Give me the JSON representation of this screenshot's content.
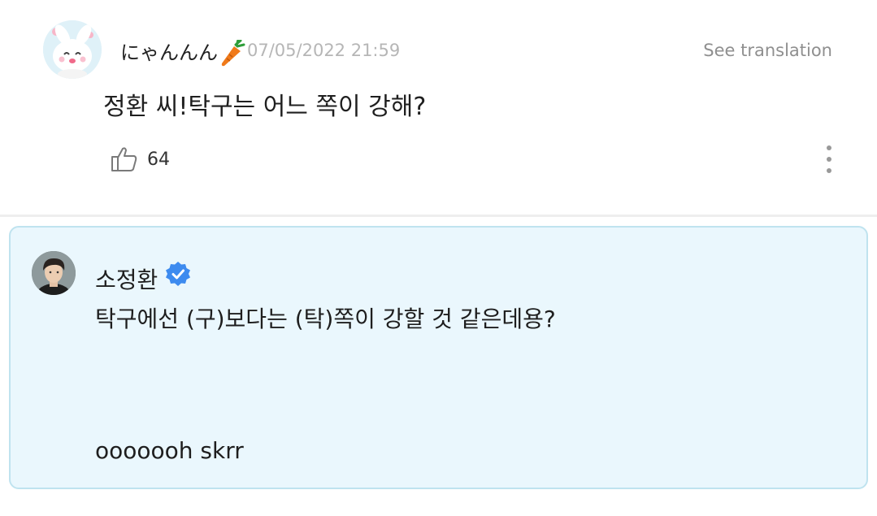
{
  "post": {
    "username": "にゃんんん",
    "username_emoji": "carrot-icon",
    "timestamp": "07/05/2022 21:59",
    "see_translation": "See translation",
    "text": "정환 씨!탁구는 어느 쪽이 강해?",
    "like_count": "64"
  },
  "reply": {
    "author": "소정환",
    "verified": true,
    "line1": "탁구에선 (구)보다는 (탁)쪽이 강할 것 같은데용?",
    "line2": "ooooooh skrr"
  },
  "colors": {
    "reply_background": "#eaf7fd",
    "reply_border": "#bfe3ef",
    "verified_badge": "#3d8bef",
    "muted_text": "#b6b6b6"
  }
}
